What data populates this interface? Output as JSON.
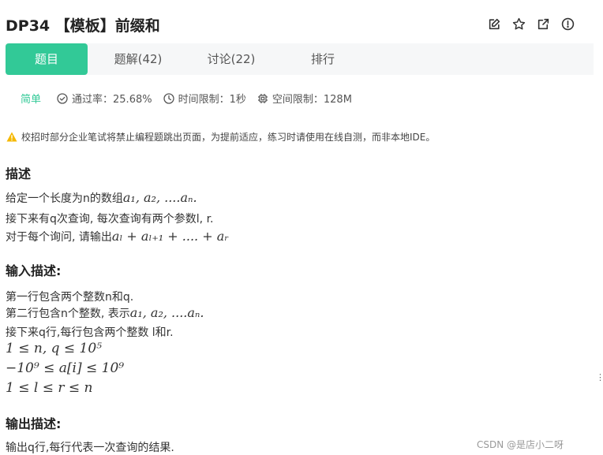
{
  "header": {
    "title": "DP34 【模板】前缀和"
  },
  "tabs": [
    {
      "label": "题目",
      "active": true
    },
    {
      "label": "题解(42)",
      "active": false
    },
    {
      "label": "讨论(22)",
      "active": false
    },
    {
      "label": "排行",
      "active": false
    }
  ],
  "meta": {
    "difficulty": "简单",
    "pass_rate": "通过率：25.68%",
    "time_limit": "时间限制：1秒",
    "memory_limit": "空间限制：128M"
  },
  "notice": "校招时部分企业笔试将禁止编程题跳出页面，为提前适应，练习时请使用在线自测，而非本地IDE。",
  "description": {
    "heading": "描述",
    "line1_text": "给定一个长度为n的数组",
    "line1_math": "a₁, a₂, ....aₙ.",
    "line2": "接下来有q次查询, 每次查询有两个参数l, r.",
    "line3_text": "对于每个询问, 请输出",
    "line3_math": "aₗ + aₗ₊₁ + .... + aᵣ"
  },
  "input": {
    "heading": "输入描述:",
    "line1": "第一行包含两个整数n和q.",
    "line2_text": "第二行包含n个整数, 表示",
    "line2_math": "a₁, a₂, ....aₙ.",
    "line3": "接下来q行,每行包含两个整数   l和r.",
    "constraint1": "1 ≤ n, q ≤ 10⁵",
    "constraint2": "−10⁹ ≤ a[i] ≤ 10⁹",
    "constraint3": "1 ≤ l ≤ r ≤ n"
  },
  "output": {
    "heading": "输出描述:",
    "line1": "输出q行,每行代表一次查询的结果."
  },
  "watermark": "CSDN @是店小二呀",
  "colors": {
    "accent": "#32c997",
    "tab_bar_bg": "#f6f7f8",
    "warning": "#f5b800"
  }
}
